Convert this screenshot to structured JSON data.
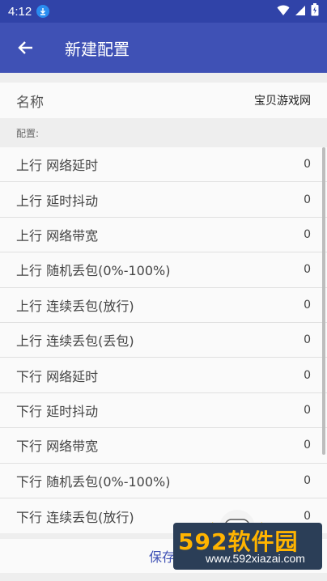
{
  "status": {
    "time": "4:12"
  },
  "app_bar": {
    "title": "新建配置"
  },
  "name_row": {
    "label": "名称",
    "value": "宝贝游戏网"
  },
  "section": {
    "label": "配置:"
  },
  "rows": [
    {
      "label": "上行 网络延时",
      "value": "0"
    },
    {
      "label": "上行 延时抖动",
      "value": "0"
    },
    {
      "label": "上行 网络带宽",
      "value": "0"
    },
    {
      "label": "上行 随机丢包(0%-100%)",
      "value": "0"
    },
    {
      "label": "上行 连续丢包(放行)",
      "value": "0"
    },
    {
      "label": "上行 连续丢包(丢包)",
      "value": "0"
    },
    {
      "label": "下行 网络延时",
      "value": "0"
    },
    {
      "label": "下行 延时抖动",
      "value": "0"
    },
    {
      "label": "下行 网络带宽",
      "value": "0"
    },
    {
      "label": "下行 随机丢包(0%-100%)",
      "value": "0"
    },
    {
      "label": "下行 连续丢包(放行)",
      "value": "0"
    }
  ],
  "save": {
    "label": "保存"
  },
  "watermark": {
    "brand": "592软件园",
    "url": "www.592xiazai.com"
  },
  "colors": {
    "status_bar": "#3043a8",
    "app_bar": "#3f51b5",
    "accent": "#3f51b5"
  }
}
